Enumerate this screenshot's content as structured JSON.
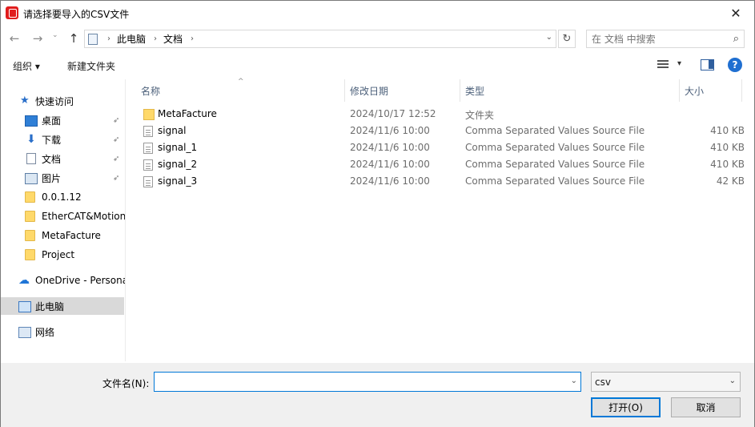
{
  "window": {
    "title": "请选择要导入的CSV文件",
    "close_glyph": "✕"
  },
  "nav": {
    "back_glyph": "←",
    "forward_glyph": "→",
    "recent_glyph": "⌄",
    "up_glyph": "↑",
    "breadcrumb": [
      "此电脑",
      "文档"
    ],
    "crumb_sep": "›",
    "address_dropdown": "⌄",
    "refresh_glyph": "↻",
    "search_placeholder": "在 文档 中搜索",
    "search_glyph": "⌕"
  },
  "toolbar": {
    "organize": "组织 ▾",
    "new_folder": "新建文件夹",
    "view_dropdown": "▾",
    "help": "?"
  },
  "sidebar": {
    "quick_access": "快速访问",
    "pin_glyph": "📌",
    "items": [
      {
        "label": "桌面",
        "pinned": true
      },
      {
        "label": "下载",
        "pinned": true
      },
      {
        "label": "文档",
        "pinned": true
      },
      {
        "label": "图片",
        "pinned": true
      },
      {
        "label": "0.0.1.12"
      },
      {
        "label": "EtherCAT&Motion"
      },
      {
        "label": "MetaFacture"
      },
      {
        "label": "Project"
      }
    ],
    "onedrive": "OneDrive - Persona",
    "this_pc": "此电脑",
    "network": "网络"
  },
  "columns": {
    "name": "名称",
    "date": "修改日期",
    "type": "类型",
    "size": "大小",
    "sort_glyph": "^"
  },
  "files": [
    {
      "name": "MetaFacture",
      "date": "2024/10/17 12:52",
      "type": "文件夹",
      "size": "",
      "icon": "folder-icon"
    },
    {
      "name": "signal",
      "date": "2024/11/6 10:00",
      "type": "Comma Separated Values Source File",
      "size": "410 KB",
      "icon": "file-icon"
    },
    {
      "name": "signal_1",
      "date": "2024/11/6 10:00",
      "type": "Comma Separated Values Source File",
      "size": "410 KB",
      "icon": "file-icon"
    },
    {
      "name": "signal_2",
      "date": "2024/11/6 10:00",
      "type": "Comma Separated Values Source File",
      "size": "410 KB",
      "icon": "file-icon"
    },
    {
      "name": "signal_3",
      "date": "2024/11/6 10:00",
      "type": "Comma Separated Values Source File",
      "size": "42 KB",
      "icon": "file-icon"
    }
  ],
  "footer": {
    "filename_label": "文件名(N):",
    "filename_value": "",
    "dropdown_glyph": "⌄",
    "filetype": "csv",
    "open": "打开(O)",
    "cancel": "取消"
  },
  "colors": {
    "accent": "#0078d7",
    "help": "#1f6fd1",
    "folder": "#ffd96a",
    "app_icon": "#e11d1d"
  }
}
